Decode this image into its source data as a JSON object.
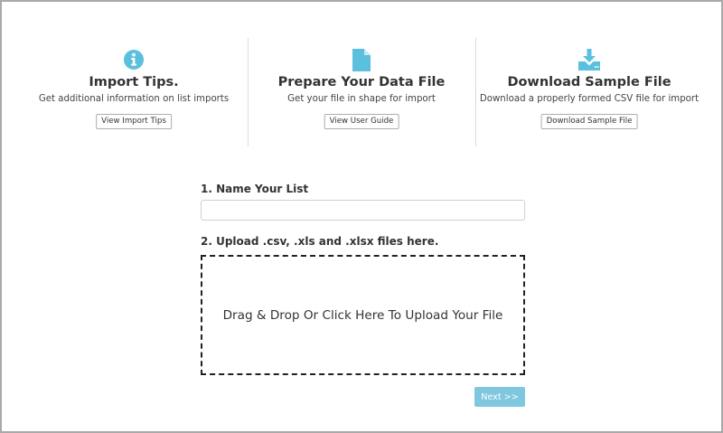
{
  "colors": {
    "accent": "#5bc0de",
    "next_button": "#7fc6df",
    "divider": "#dcdcdc",
    "border": "#a9a9a9"
  },
  "cards": [
    {
      "icon": "info-circle-icon",
      "title": "Import Tips.",
      "subtitle": "Get additional information on list imports",
      "button": "View Import Tips"
    },
    {
      "icon": "file-icon",
      "title": "Prepare Your Data File",
      "subtitle": "Get your file in shape for import",
      "button": "View User Guide"
    },
    {
      "icon": "download-icon",
      "title": "Download Sample File",
      "subtitle": "Download a properly formed CSV file for import",
      "button": "Download Sample File"
    }
  ],
  "form": {
    "name_label": "1. Name Your List",
    "name_value": "",
    "name_placeholder": "",
    "upload_label": "2. Upload .csv, .xls and .xlsx files here.",
    "dropzone_text": "Drag & Drop Or Click Here To Upload Your File",
    "next_label": "Next >>"
  }
}
